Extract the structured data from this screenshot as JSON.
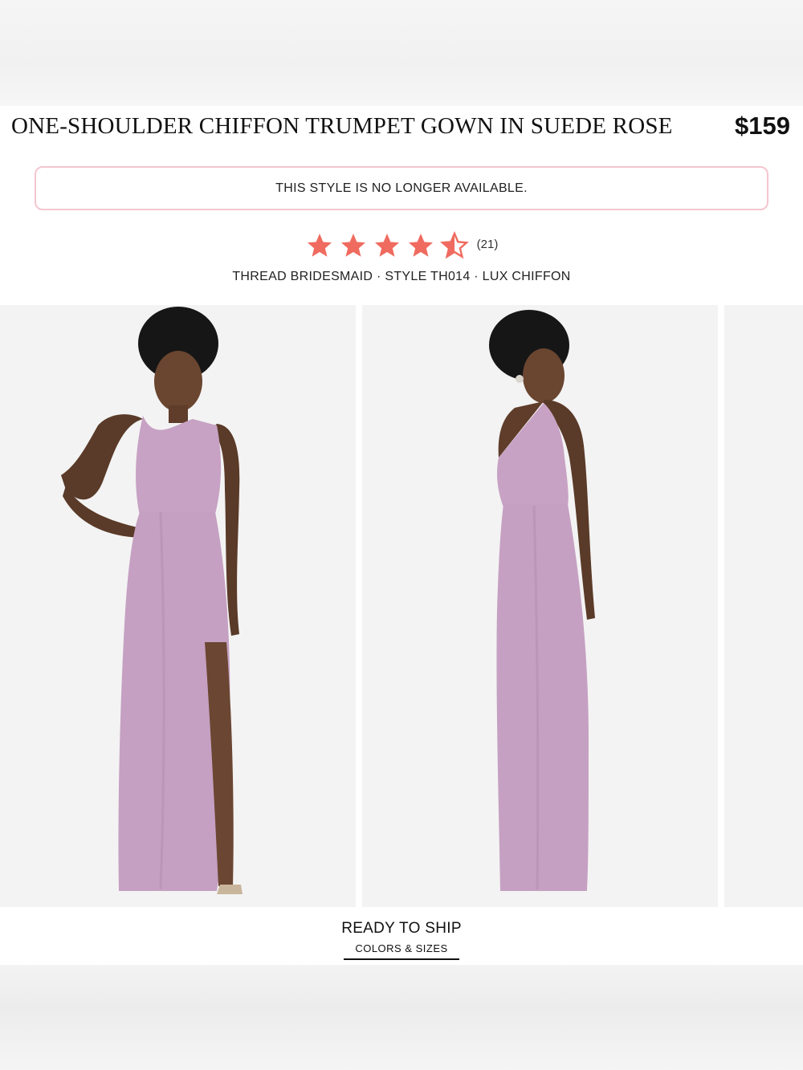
{
  "product": {
    "title": "ONE-SHOULDER CHIFFON TRUMPET GOWN IN SUEDE ROSE",
    "price": "$159"
  },
  "notice": {
    "text": "THIS STYLE IS NO LONGER AVAILABLE."
  },
  "rating": {
    "value": 4.5,
    "max": 5,
    "count_label": "(21)",
    "star_color": "#f06b5f"
  },
  "meta": {
    "text": "THREAD BRIDESMAID · STYLE TH014 · LUX CHIFFON"
  },
  "gallery": {
    "dress_color": "#c7a2c4",
    "photos": [
      "front-view",
      "back-view",
      "partial-next"
    ]
  },
  "shipping": {
    "title": "READY TO SHIP",
    "link": "COLORS & SIZES"
  }
}
